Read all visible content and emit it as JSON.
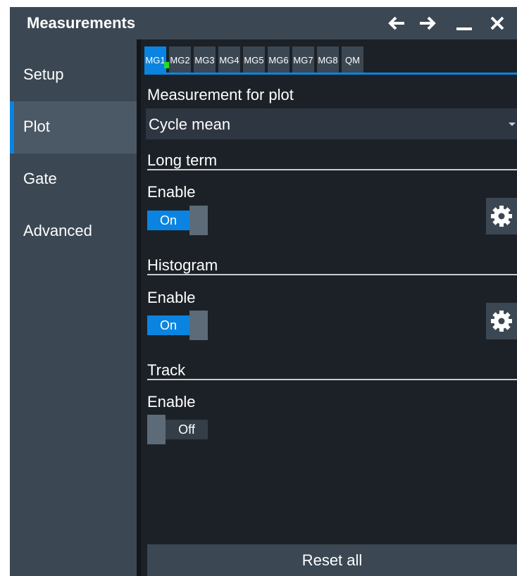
{
  "window": {
    "title": "Measurements"
  },
  "titlebar": {
    "icons": [
      "arrow-left-icon",
      "arrow-right-icon",
      "minimize-icon",
      "close-icon"
    ]
  },
  "sidebar": {
    "items": [
      {
        "label": "Setup",
        "active": false
      },
      {
        "label": "Plot",
        "active": true
      },
      {
        "label": "Gate",
        "active": false
      },
      {
        "label": "Advanced",
        "active": false
      }
    ]
  },
  "tabs": [
    {
      "label": "MG1",
      "active": true
    },
    {
      "label": "MG2",
      "active": false
    },
    {
      "label": "MG3",
      "active": false
    },
    {
      "label": "MG4",
      "active": false
    },
    {
      "label": "MG5",
      "active": false
    },
    {
      "label": "MG6",
      "active": false
    },
    {
      "label": "MG7",
      "active": false
    },
    {
      "label": "MG8",
      "active": false
    },
    {
      "label": "QM",
      "active": false
    }
  ],
  "measurement": {
    "label": "Measurement for plot",
    "value": "Cycle mean"
  },
  "long_term": {
    "heading": "Long term",
    "enable_label": "Enable",
    "toggle": "On"
  },
  "histogram": {
    "heading": "Histogram",
    "enable_label": "Enable",
    "toggle": "On"
  },
  "track": {
    "heading": "Track",
    "enable_label": "Enable",
    "toggle": "Off"
  },
  "reset_label": "Reset all",
  "colors": {
    "accent": "#0a84e0",
    "panel": "#1c2127",
    "sidebar": "#3b4753",
    "indicator": "#22dd22"
  }
}
